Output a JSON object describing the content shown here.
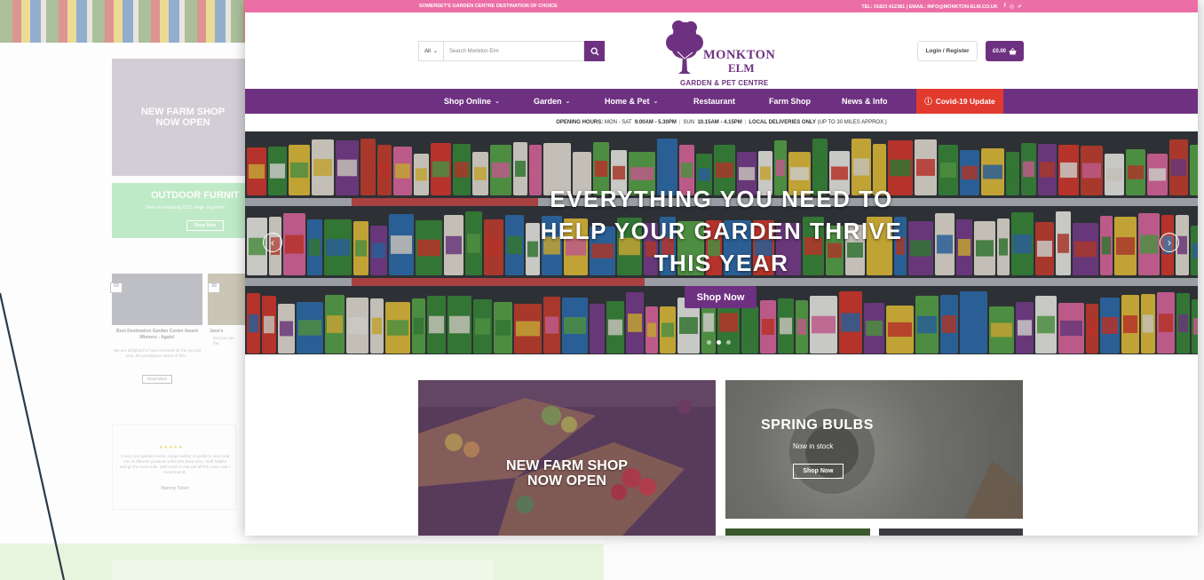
{
  "background_page": {
    "farm_tile": {
      "line1": "NEW FARM SHOP",
      "line2": "NOW OPEN"
    },
    "outdoor_tile": {
      "title": "OUTDOOR FURNIT",
      "subtitle": "View our amazing 2021 range of garden",
      "button": "Shop Now"
    },
    "news": [
      {
        "date_top": "03",
        "date_bottom": "MAR",
        "title": "Best Destination Garden Centre Award Winners - Again!",
        "text": "We are delighted to have received for the second time, the prestigious award of this...",
        "button": "Read More"
      },
      {
        "date_top": "29",
        "date_bottom": "FEB",
        "title": "Jane's",
        "text": "Did you use the"
      }
    ],
    "review": {
      "stars": "★★★★★",
      "text": "A very nice garden centre. Large variety of goods in store and lots of different products within the plant area. Staff helpful and go the extra mile. Well worth a visit just off the main road I recommend.",
      "author": "Harvey Tobin"
    }
  },
  "topbar": {
    "tagline": "SOMERSET'S GARDEN CENTRE DESTINATION OF CHOICE",
    "contact": "TEL: 01823 412381 | EMAIL: INFO@MONKTON-ELM.CO.UK",
    "social_icons": [
      "facebook-icon",
      "instagram-icon",
      "twitter-icon"
    ]
  },
  "search": {
    "category": "All",
    "placeholder": "Search Monkton Elm"
  },
  "logo": {
    "line1": "MONKTON",
    "line2": "ELM",
    "tagline": "GARDEN & PET CENTRE"
  },
  "account": {
    "login_label": "Login / Register",
    "cart_total": "£0.00"
  },
  "nav": {
    "items": [
      {
        "label": "Shop Online",
        "dropdown": true
      },
      {
        "label": "Garden",
        "dropdown": true
      },
      {
        "label": "Home & Pet",
        "dropdown": true
      },
      {
        "label": "Restaurant",
        "dropdown": false
      },
      {
        "label": "Farm Shop",
        "dropdown": false
      },
      {
        "label": "News & Info",
        "dropdown": false
      }
    ],
    "covid_label": "Covid-19 Update"
  },
  "hours": {
    "label": "OPENING HOURS:",
    "weekday_days": "MON - SAT",
    "weekday_time": "9.00AM - 5.30PM",
    "sunday_day": "SUN",
    "sunday_time": "10.15AM - 4.15PM",
    "delivery_label": "LOCAL DELIVERIES ONLY",
    "delivery_note": "(UP TO 30 MILES APPROX.)"
  },
  "hero": {
    "heading_line1": "EVERYTHING YOU NEED TO",
    "heading_line2": "HELP YOUR GARDEN THRIVE",
    "heading_line3": "THIS YEAR",
    "button": "Shop Now",
    "slides": 3,
    "active_slide": 1
  },
  "promos": {
    "farm": {
      "line1": "NEW FARM SHOP",
      "line2": "NOW OPEN"
    },
    "bulbs": {
      "title": "SPRING BULBS",
      "subtitle": "Now in stock",
      "button": "Shop Now"
    }
  },
  "colors": {
    "brand_purple": "#6e3181",
    "topbar_pink": "#eb6fa6",
    "covid_red": "#e23a2e"
  }
}
